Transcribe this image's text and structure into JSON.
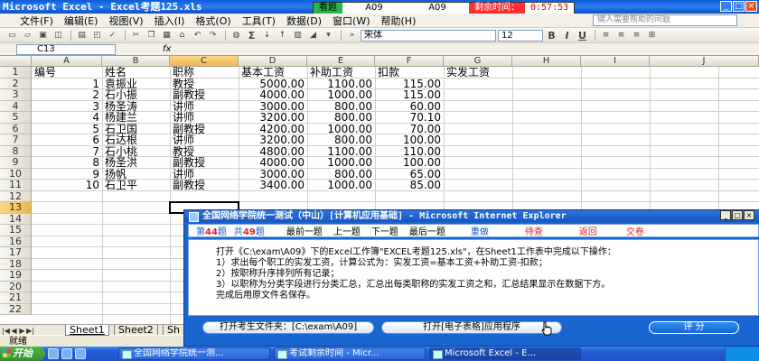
{
  "window": {
    "title": "Microsoft Excel - Excel考题125.xls"
  },
  "exam_status": {
    "label_view": "看题",
    "code1": "A09",
    "code2": "A09",
    "remaining_label": "剩余时间：",
    "remaining_time": "0:57:53"
  },
  "menu": [
    "文件(F)",
    "编辑(E)",
    "视图(V)",
    "插入(I)",
    "格式(O)",
    "工具(T)",
    "数据(D)",
    "窗口(W)",
    "帮助(H)"
  ],
  "help_placeholder": "键入需要帮助的问题",
  "toolbar": {
    "font_name": "宋体",
    "font_size": "12",
    "bold": "B",
    "italic": "I",
    "underline": "U",
    "sigma": "Σ"
  },
  "namebox": "C13",
  "fx": "fx",
  "columns": [
    "A",
    "B",
    "C",
    "D",
    "E",
    "F",
    "G",
    "H",
    "I",
    "J"
  ],
  "rows": [
    "1",
    "2",
    "3",
    "4",
    "5",
    "6",
    "7",
    "8",
    "9",
    "10",
    "11",
    "12",
    "13",
    "14",
    "15",
    "16",
    "17",
    "18",
    "19",
    "20",
    "21",
    "22"
  ],
  "headers": [
    "编号",
    "姓名",
    "职称",
    "基本工资",
    "补助工资",
    "扣款",
    "实发工资"
  ],
  "table": [
    [
      "1",
      "袁振业",
      "教授",
      "5000.00",
      "1100.00",
      "115.00"
    ],
    [
      "2",
      "石小振",
      "副教授",
      "4000.00",
      "1000.00",
      "115.00"
    ],
    [
      "3",
      "杨圣涛",
      "讲师",
      "3000.00",
      "800.00",
      "60.00"
    ],
    [
      "4",
      "杨建兰",
      "讲师",
      "3200.00",
      "800.00",
      "70.10"
    ],
    [
      "5",
      "石卫国",
      "副教授",
      "4200.00",
      "1000.00",
      "70.00"
    ],
    [
      "6",
      "石达根",
      "讲师",
      "3200.00",
      "800.00",
      "100.00"
    ],
    [
      "7",
      "石小桃",
      "教授",
      "4800.00",
      "1100.00",
      "110.00"
    ],
    [
      "8",
      "杨圣洪",
      "副教授",
      "4000.00",
      "1000.00",
      "100.00"
    ],
    [
      "9",
      "扬帆",
      "讲师",
      "3000.00",
      "800.00",
      "65.00"
    ],
    [
      "10",
      "石卫平",
      "副教授",
      "3400.00",
      "1000.00",
      "85.00"
    ]
  ],
  "sheets": [
    "Sheet1",
    "Sheet2",
    "Sh"
  ],
  "status": "就绪",
  "taskbar": {
    "start": "开始",
    "tasks": [
      "全国网络学院统一测...",
      "考试剩余时间 - Micr...",
      "Microsoft Excel - E..."
    ]
  },
  "dialog": {
    "title": "全国网络学院统一测试（中山）[计算机应用基础] - Microsoft Internet Explorer",
    "q_prefix": "第",
    "q_num": "44",
    "q_suffix": "题",
    "total_prefix": "共",
    "total_num": "49",
    "total_suffix": "题",
    "nav": [
      "最前一题",
      "上一题",
      "下一题",
      "最后一题"
    ],
    "actions": [
      "重做",
      "待查",
      "返回",
      "交卷"
    ],
    "body": [
      "打开《C:\\exam\\A09》下的Excel工作簿\"EXCEL考题125.xls\"，在Sheet1工作表中完成以下操作：",
      "1）求出每个职工的实发工资，计算公式为：实发工资=基本工资+补助工资-扣款；",
      "2）按职称升序排列所有记录；",
      "3）以职称为分类字段进行分类汇总，汇总出每类职称的实发工资之和，汇总结果显示在数据下方。",
      "完成后用原文件名保存。"
    ],
    "btn_open_folder": "打开考生文件夹：[C:\\exam\\A09]",
    "btn_open_app": "打开[电子表格]应用程序",
    "btn_score": "评 分"
  }
}
